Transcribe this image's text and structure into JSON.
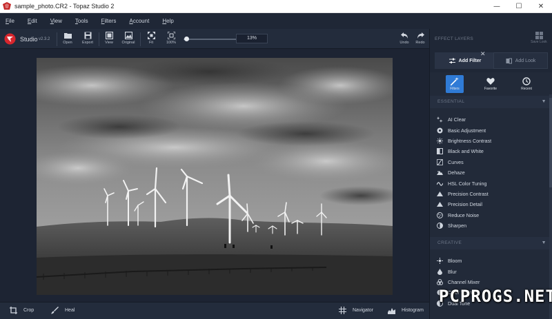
{
  "window": {
    "title": "sample_photo.CR2 - Topaz Studio 2",
    "controls": [
      "—",
      "☐",
      "✕"
    ]
  },
  "menu": [
    {
      "accel": "F",
      "rest": "ile"
    },
    {
      "accel": "E",
      "rest": "dit"
    },
    {
      "accel": "V",
      "rest": "iew"
    },
    {
      "accel": "T",
      "rest": "ools"
    },
    {
      "accel": "F",
      "rest": "ilters"
    },
    {
      "accel": "A",
      "rest": "ccount"
    },
    {
      "accel": "H",
      "rest": "elp"
    }
  ],
  "toolbar": {
    "app_name": "Studio",
    "version": "v2.3.2",
    "open": "Open",
    "export": "Export",
    "view": "View",
    "original": "Original",
    "fit": "Fit",
    "zoom100": "100%",
    "zoom_value": "13%",
    "zoom_level": 0.13,
    "undo": "Undo",
    "redo": "Redo"
  },
  "bottom": {
    "crop": "Crop",
    "heal": "Heal",
    "navigator": "Navigator",
    "histogram": "Histogram"
  },
  "panel": {
    "header": "EFFECT LAYERS",
    "save_look": "Save Look",
    "tab_add": "Add Filter",
    "tab_look": "Add Look",
    "icon_tabs": {
      "filters": "Filters",
      "favorite": "Favorite",
      "recent": "Recent"
    },
    "essential_title": "ESSENTIAL",
    "essential": [
      "AI Clear",
      "Basic Adjustment",
      "Brightness Contrast",
      "Black and White",
      "Curves",
      "Dehaze",
      "HSL Color Tuning",
      "Precision Contrast",
      "Precision Detail",
      "Reduce Noise",
      "Sharpen"
    ],
    "creative_title": "CREATIVE",
    "creative": [
      "Bloom",
      "Blur",
      "Channel Mixer",
      "Color Theme",
      "Dual Tone"
    ]
  },
  "watermark": "PCPROGS.NET",
  "colors": {
    "accent": "#2f7bd6",
    "panel_bg": "#222a39",
    "brand_red": "#d8262d"
  }
}
